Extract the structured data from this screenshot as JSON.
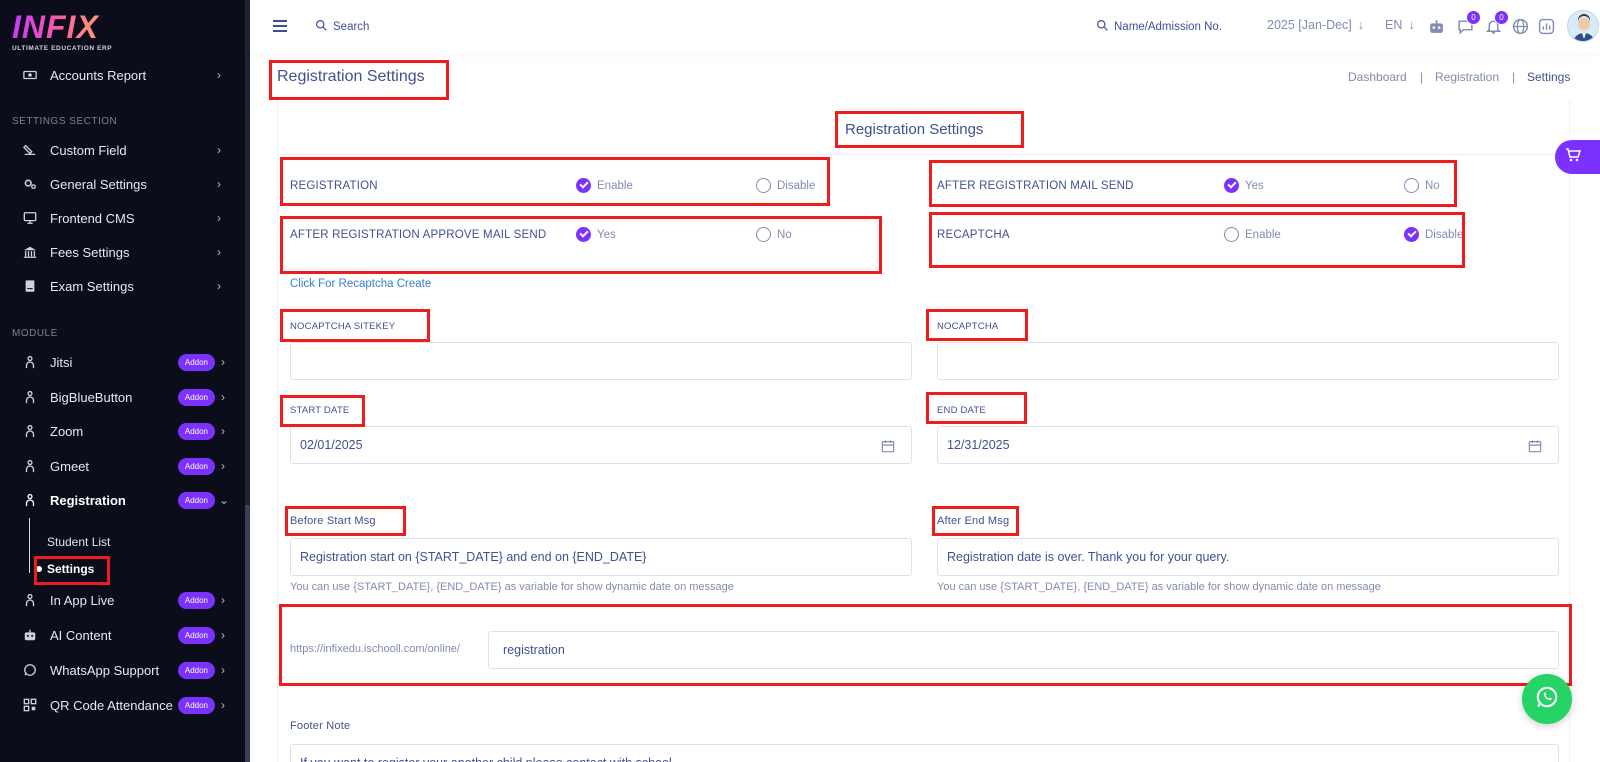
{
  "logo": {
    "main": "INFIX",
    "sub": "ULTIMATE EDUCATION ERP"
  },
  "sidebar": {
    "top_item": {
      "label": "Accounts Report"
    },
    "settings_section": "SETTINGS SECTION",
    "settings_items": [
      {
        "label": "Custom Field",
        "icon": "custom-field-icon"
      },
      {
        "label": "General Settings",
        "icon": "gear-icon"
      },
      {
        "label": "Frontend CMS",
        "icon": "monitor-icon"
      },
      {
        "label": "Fees Settings",
        "icon": "bank-icon"
      },
      {
        "label": "Exam Settings",
        "icon": "book-icon"
      }
    ],
    "module_section": "MODULE",
    "module_items": [
      {
        "label": "Jitsi",
        "badge": "Addon"
      },
      {
        "label": "BigBlueButton",
        "badge": "Addon"
      },
      {
        "label": "Zoom",
        "badge": "Addon"
      },
      {
        "label": "Gmeet",
        "badge": "Addon"
      },
      {
        "label": "Registration",
        "badge": "Addon"
      },
      {
        "label": "In App Live",
        "badge": "Addon"
      },
      {
        "label": "AI Content",
        "badge": "Addon"
      },
      {
        "label": "WhatsApp Support",
        "badge": "Addon"
      },
      {
        "label": "QR Code Attendance",
        "badge": "Addon"
      }
    ],
    "registration_sub": [
      "Student List",
      "Settings"
    ]
  },
  "header": {
    "search_label": "Search",
    "admission_search": "Name/Admission No.",
    "session": "2025 [Jan-Dec]",
    "language": "EN",
    "messages_badge": "0",
    "notifications_badge": "0"
  },
  "page": {
    "title": "Registration Settings",
    "breadcrumb": [
      "Dashboard",
      "Registration",
      "Settings"
    ],
    "card_title": "Registration Settings"
  },
  "form": {
    "registration": {
      "label": "REGISTRATION",
      "options": [
        "Enable",
        "Disable"
      ],
      "selected": "Enable"
    },
    "after_mail": {
      "label": "AFTER REGISTRATION MAIL SEND",
      "options": [
        "Yes",
        "No"
      ],
      "selected": "Yes"
    },
    "approve_mail": {
      "label": "AFTER REGISTRATION APPROVE MAIL SEND",
      "options": [
        "Yes",
        "No"
      ],
      "selected": "Yes"
    },
    "recaptcha": {
      "label": "RECAPTCHA",
      "options": [
        "Enable",
        "Disable"
      ],
      "selected": "Disable"
    },
    "recaptcha_link": "Click For Recaptcha Create",
    "nocaptcha_sitekey": {
      "label": "NOCAPTCHA SITEKEY",
      "value": ""
    },
    "nocaptcha": {
      "label": "NOCAPTCHA",
      "value": ""
    },
    "start_date": {
      "label": "START DATE",
      "value": "02/01/2025"
    },
    "end_date": {
      "label": "END DATE",
      "value": "12/31/2025"
    },
    "before_start_msg": {
      "label": "Before Start Msg",
      "value": "Registration start on {START_DATE} and end on {END_DATE}",
      "hint": "You can use {START_DATE}, {END_DATE} as variable for show dynamic date on message"
    },
    "after_end_msg": {
      "label": "After End Msg",
      "value": "Registration date is over. Thank you for your query.",
      "hint": "You can use {START_DATE}, {END_DATE} as variable for show dynamic date on message"
    },
    "url_prefix": "https://infixedu.ischooll.com/online/",
    "url_slug": "registration",
    "footer_note": {
      "label": "Footer Note",
      "value": "If you want to register your another child please contact with school"
    }
  },
  "colors": {
    "accent": "#7c32ff",
    "sidebar_bg": "#0b0d1a",
    "text": "#415094",
    "annotation": "#ee1c1c",
    "whatsapp": "#25d366"
  }
}
